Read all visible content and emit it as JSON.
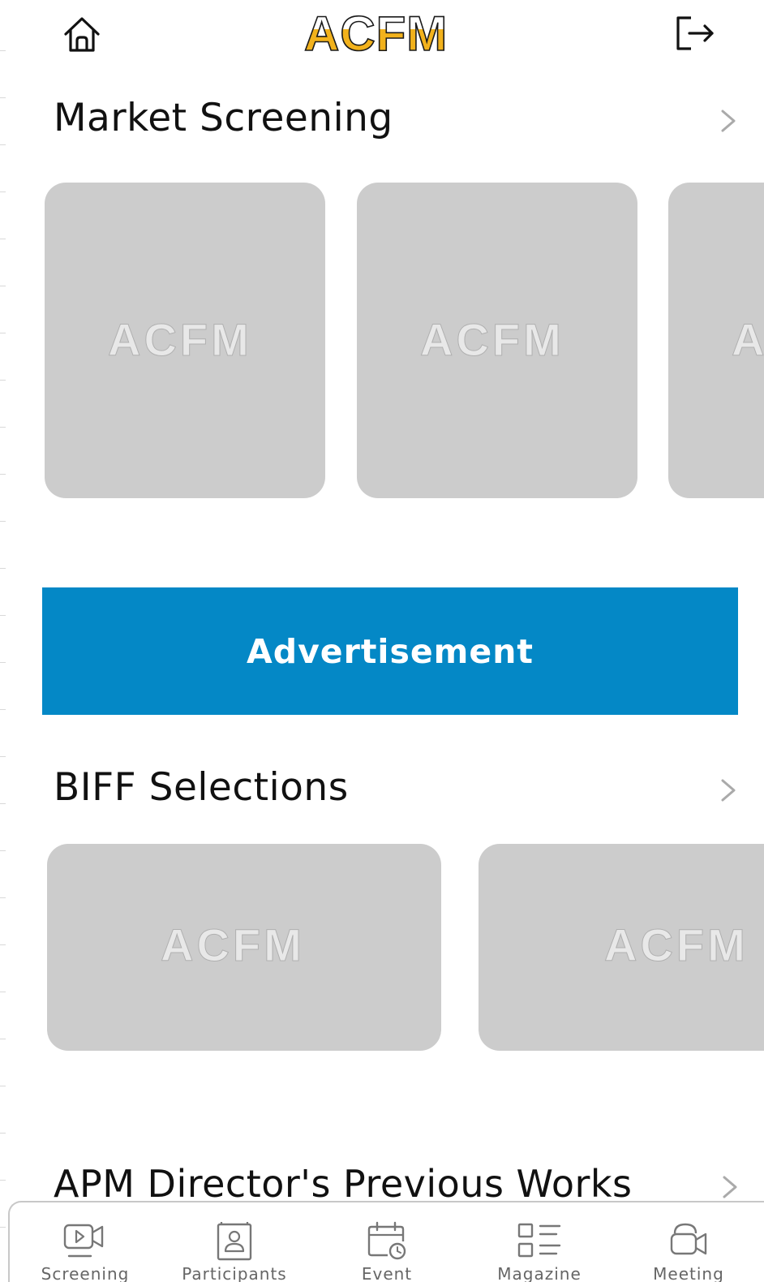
{
  "app": {
    "logo_text": "ACFM",
    "brand_color": "#f2b21c",
    "accent_color": "#0488c6",
    "placeholder_text": "ACFM"
  },
  "header": {
    "left_icon": "home-icon",
    "right_icon": "logout-icon"
  },
  "sections": {
    "market_screening": {
      "title": "Market Screening",
      "chevron": ">"
    },
    "biff_selections": {
      "title": "BIFF Selections",
      "chevron": ">"
    },
    "apm_previous_works": {
      "title": "APM Director's Previous Works",
      "chevron": ">"
    }
  },
  "advertisement": {
    "label": "Advertisement"
  },
  "tabbar": {
    "tabs": [
      {
        "label": "Screening",
        "icon": "video-play-icon"
      },
      {
        "label": "Participants",
        "icon": "contact-book-icon"
      },
      {
        "label": "Event",
        "icon": "calendar-clock-icon"
      },
      {
        "label": "Magazine",
        "icon": "grid-list-icon"
      },
      {
        "label": "Meeting",
        "icon": "video-call-icon"
      }
    ]
  }
}
